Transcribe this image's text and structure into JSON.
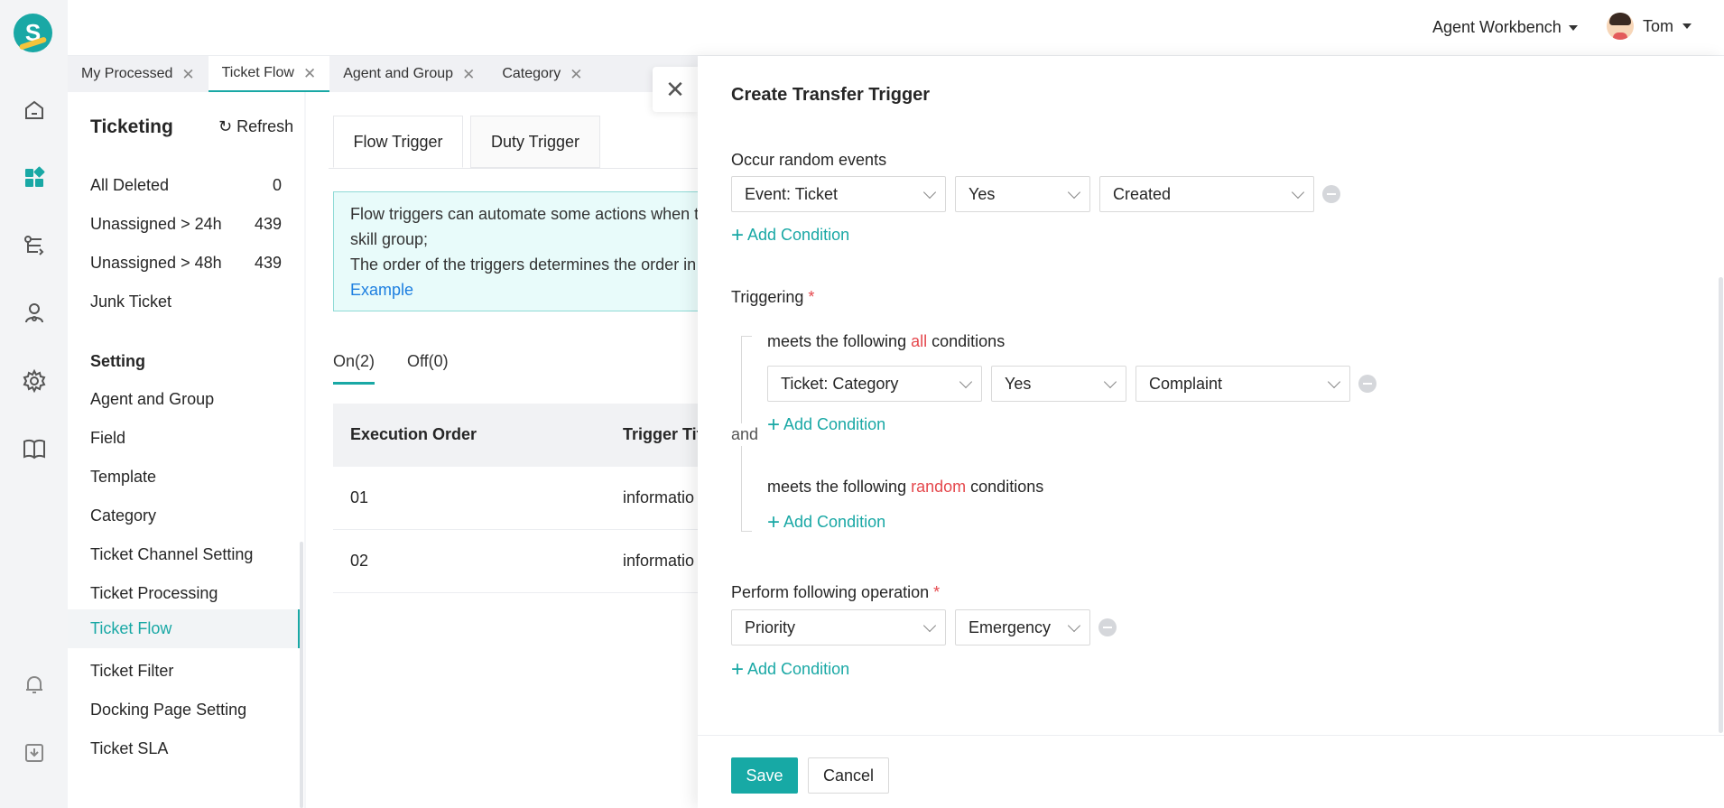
{
  "header": {
    "workbench": "Agent Workbench",
    "user": "Tom"
  },
  "tabs": [
    {
      "label": "My Processed"
    },
    {
      "label": "Ticket Flow"
    },
    {
      "label": "Agent and Group"
    },
    {
      "label": "Category"
    }
  ],
  "sidebar": {
    "title": "Ticketing",
    "refresh": "Refresh",
    "queues": [
      {
        "label": "All Deleted",
        "count": "0"
      },
      {
        "label": "Unassigned > 24h",
        "count": "439"
      },
      {
        "label": "Unassigned > 48h",
        "count": "439"
      },
      {
        "label": "Junk Ticket",
        "count": ""
      }
    ],
    "setting_title": "Setting",
    "settings": [
      "Agent and Group",
      "Field",
      "Template",
      "Category",
      "Ticket Channel Setting",
      "Ticket Processing",
      "Ticket Flow",
      "Ticket Filter",
      "Docking Page Setting",
      "Ticket SLA"
    ]
  },
  "main": {
    "subtabs": [
      "Flow Trigger",
      "Duty Trigger"
    ],
    "notice": {
      "line1": "Flow triggers can automate some actions when tic",
      "line2": "skill group;",
      "line3": "The order of the triggers determines the order in v",
      "link": "Example"
    },
    "status_tabs": [
      "On(2)",
      "Off(0)"
    ],
    "table": {
      "headers": [
        "Execution Order",
        "Trigger Tit"
      ],
      "rows": [
        {
          "order": "01",
          "title": "informatio"
        },
        {
          "order": "02",
          "title": "informatio"
        }
      ]
    }
  },
  "drawer": {
    "title": "Create Transfer Trigger",
    "occur_label": "Occur random events",
    "occur": {
      "field": "Event: Ticket",
      "op": "Yes",
      "value": "Created"
    },
    "add_condition": "Add Condition",
    "triggering_label": "Triggering",
    "required_mark": "*",
    "and_label": "and",
    "all_group": {
      "prefix": "meets the following",
      "keyword": "all",
      "suffix": "conditions"
    },
    "all_condition": {
      "field": "Ticket: Category",
      "op": "Yes",
      "value": "Complaint"
    },
    "random_group": {
      "prefix": "meets the following",
      "keyword": "random",
      "suffix": "conditions"
    },
    "perform_label": "Perform following operation",
    "operation": {
      "field": "Priority",
      "value": "Emergency"
    },
    "save": "Save",
    "cancel": "Cancel"
  },
  "colors": {
    "accent": "#19a8a5",
    "danger": "#e5484d",
    "link": "#1d7fe0"
  }
}
